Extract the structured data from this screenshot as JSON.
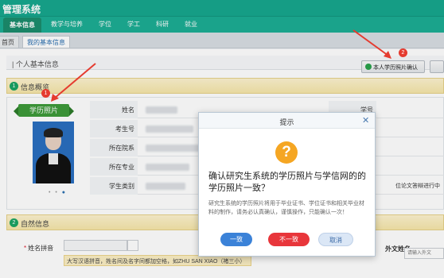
{
  "header": {
    "title": "管理系统"
  },
  "nav": {
    "items": [
      "基本信息",
      "教学与培养",
      "学位",
      "学工",
      "科研",
      "就业"
    ]
  },
  "page_tabs": [
    "首页",
    "我的基本信息"
  ],
  "page": {
    "section_title": "个人基本信息",
    "confirm_button": "本人学历照片确认",
    "overview": {
      "num": "1",
      "title": "信息概览"
    },
    "ribbon": "学历照片",
    "photo_dots": "• • ●",
    "fields": [
      "姓名",
      "考生号",
      "所在院系",
      "所在专业",
      "学生类别"
    ],
    "right_fields": {
      "xuehao": "学号",
      "thesis_note": "位论文答辩进行中"
    },
    "natural": {
      "num": "2",
      "title": "自然信息"
    },
    "pinyin_label": "姓名拼音",
    "pinyin_tip": "大写汉语拼音，姓名间及名字间都加空格，如ZHU SAN XIAO（褚三小）",
    "foreign_name_label": "外文姓名",
    "foreign_name_placeholder": "请输入外文"
  },
  "dialog": {
    "title": "提示",
    "question": "确认研究生系统的学历照片与学信网的的学历照片一致？",
    "description": "研究生系统的学历照片将用于毕业证书、学位证书和相关毕业材料的制作，请务必认真确认，谨慎操作，只能确认一次！",
    "buttons": {
      "yes": "一致",
      "no": "不一致",
      "cancel": "取消"
    }
  },
  "annotations": {
    "one": "1",
    "two": "2"
  },
  "colors": {
    "accent": "#1cae94",
    "ok_green": "#29a24b",
    "danger": "#e8363b",
    "primary": "#3b82d8",
    "warning": "#f5a623"
  },
  "icons": [
    "close-icon",
    "question-icon",
    "check-circle-icon"
  ]
}
